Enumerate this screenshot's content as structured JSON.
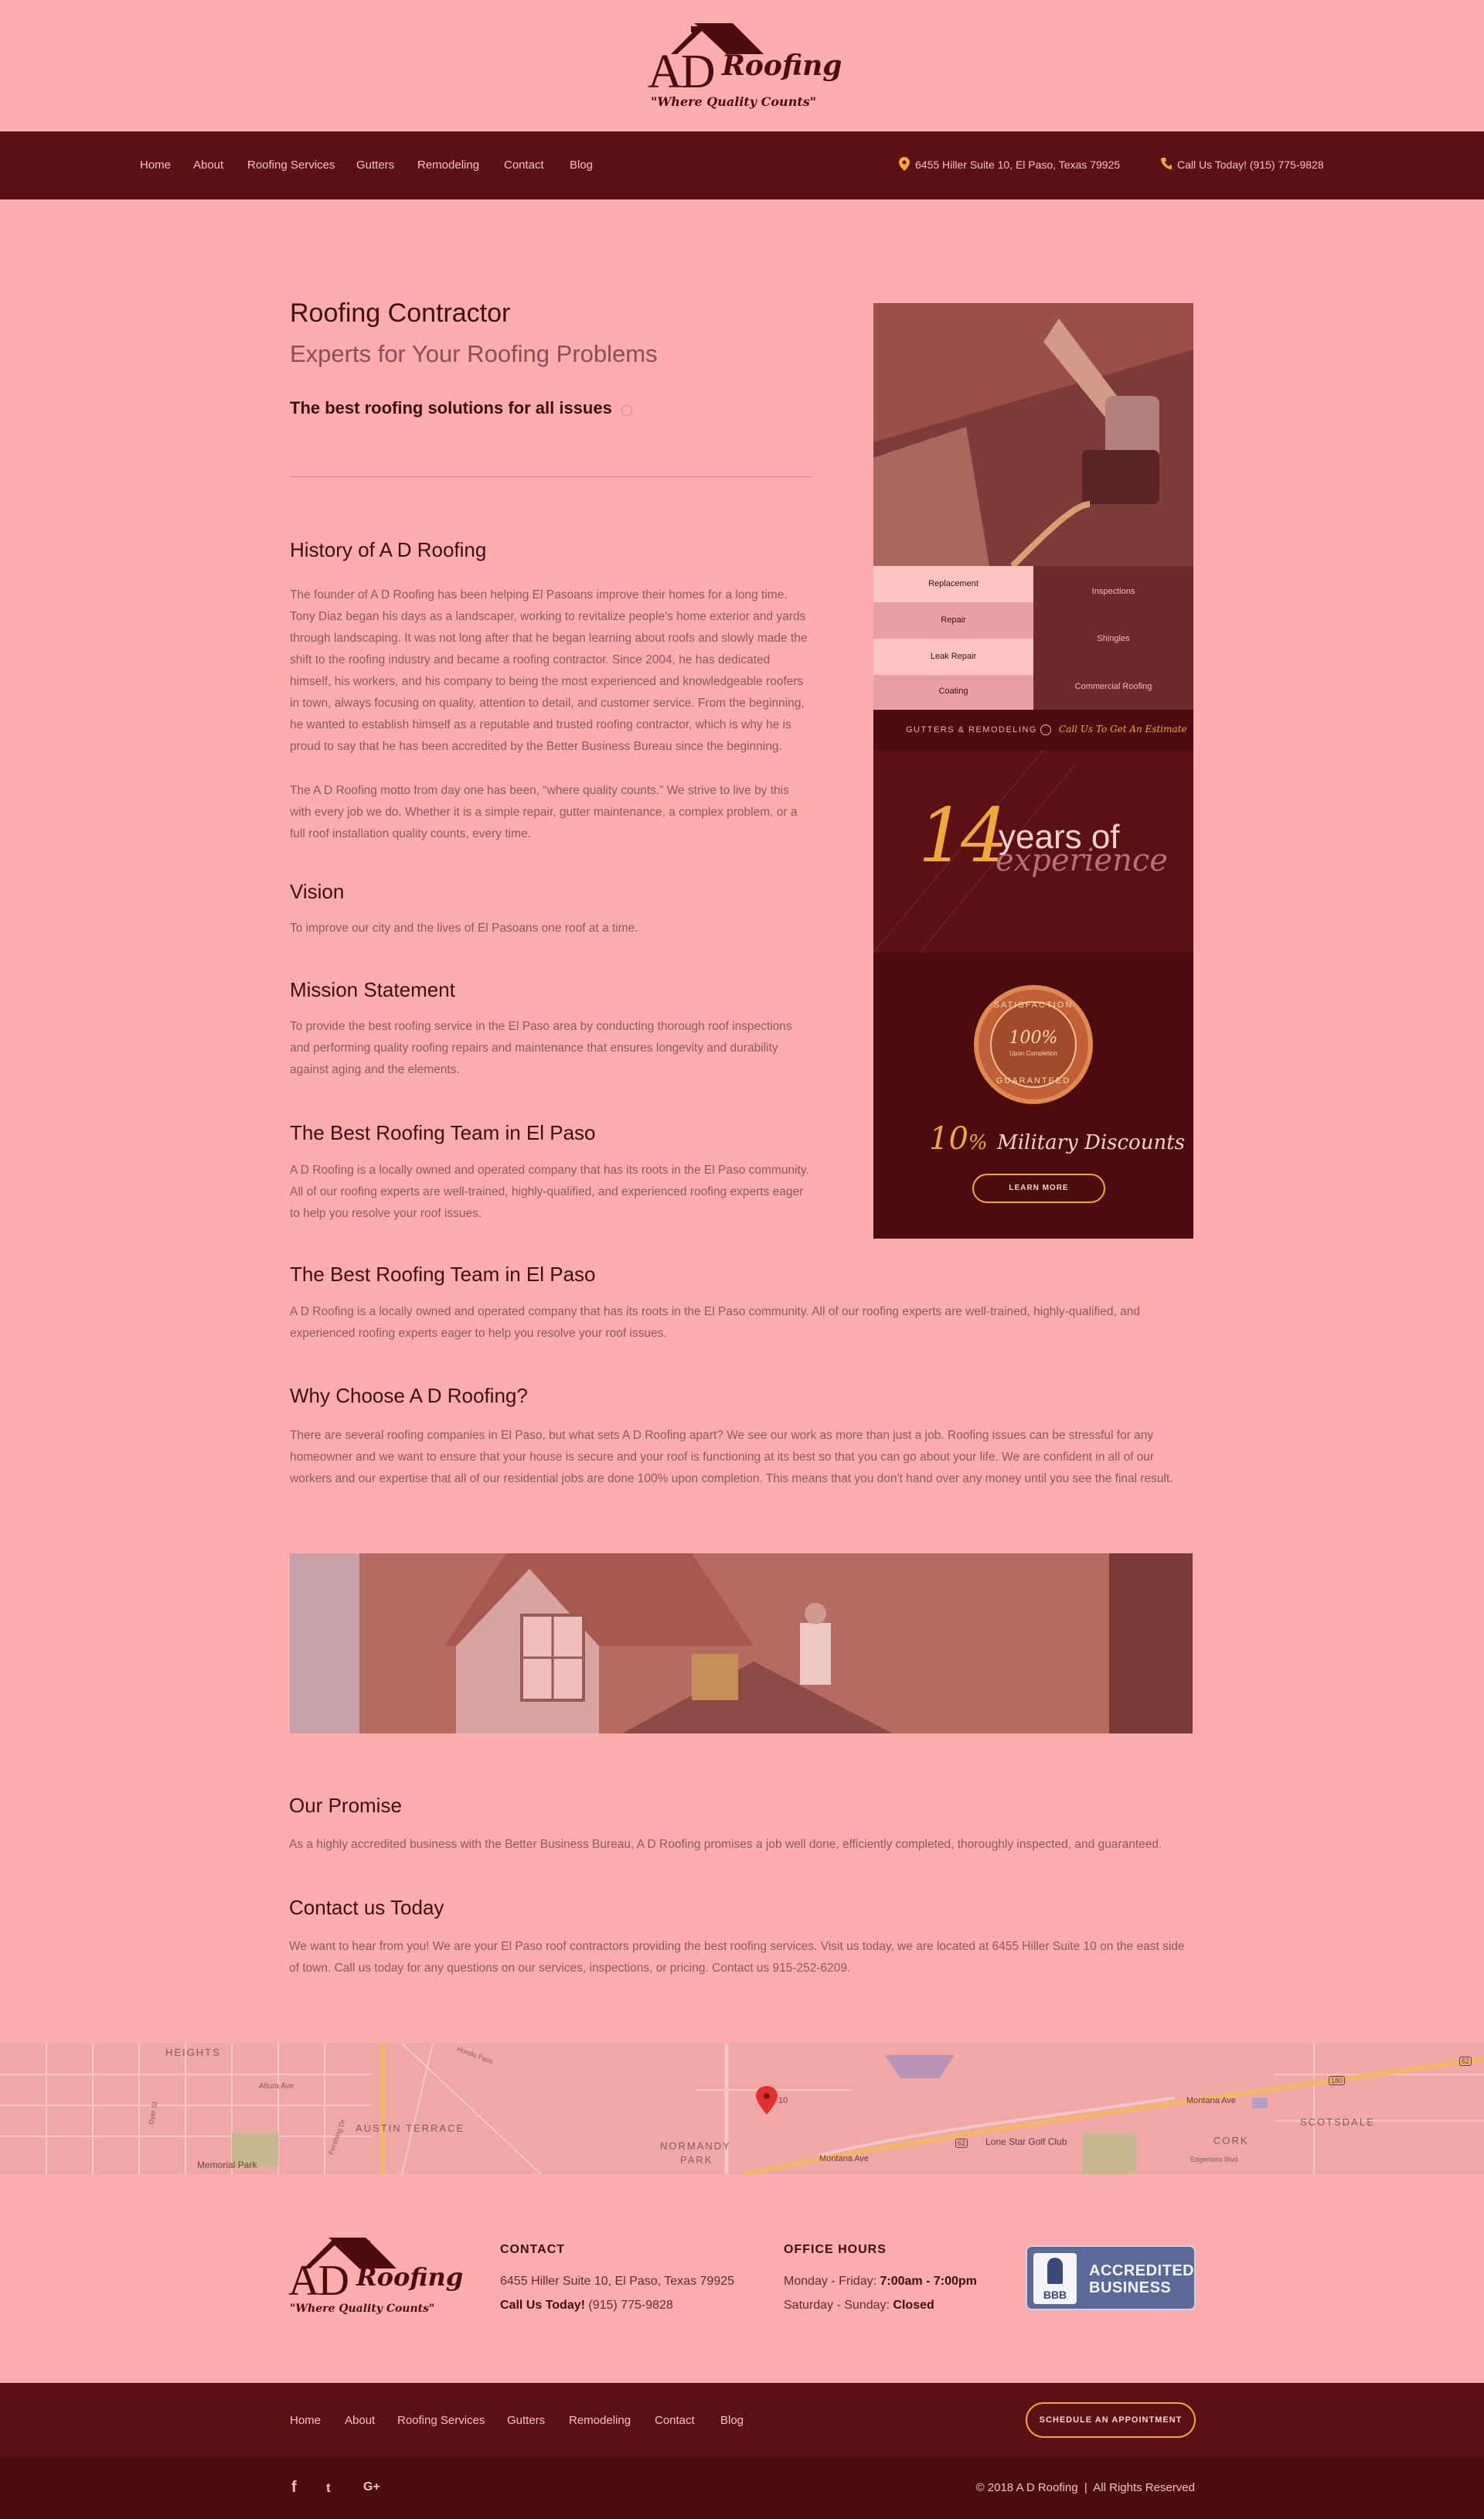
{
  "brand": {
    "name_big": "AD",
    "name_script": "Roofing",
    "tagline": "\"Where Quality Counts\""
  },
  "nav": {
    "items": [
      "Home",
      "About",
      "Roofing Services",
      "Gutters",
      "Remodeling",
      "Contact",
      "Blog"
    ],
    "address": "6455 Hiller Suite 10, El Paso, Texas 79925",
    "phone": "Call Us Today! (915) 775-9828"
  },
  "intro": {
    "title": "Roofing Contractor",
    "subtitle": "Experts for Your Roofing Problems",
    "tagline": "The best roofing solutions for all issues"
  },
  "sections": [
    {
      "heading": "History of A D Roofing",
      "paragraphs": [
        "The founder of A D Roofing has been helping El Pasoans improve their homes for a long time. Tony Diaz began his days as a landscaper, working to revitalize people's home exterior and yards through landscaping. It was not long after that he began learning about roofs and slowly made the shift to the roofing industry and became a roofing contractor. Since 2004, he has dedicated himself, his workers, and his company to being the most experienced and knowledgeable roofers in town, always focusing on quality, attention to detail, and customer service. From the beginning, he wanted to establish himself as a reputable and trusted roofing contractor, which is why he is proud to say that he has been accredited by the Better Business Bureau since the beginning.",
        "The A D Roofing motto from day one has been, “where quality counts.” We strive to live by this with every job we do. Whether it is a simple repair, gutter maintenance, a complex problem, or a full roof installation quality counts, every time."
      ]
    },
    {
      "heading": "Vision",
      "paragraphs": [
        "To improve our city and the lives of El Pasoans one roof at a time."
      ]
    },
    {
      "heading": "Mission Statement",
      "paragraphs": [
        "To provide the best roofing service in the El Paso area by conducting thorough roof inspections and performing quality roofing repairs and maintenance that ensures longevity and durability against aging and the elements."
      ]
    },
    {
      "heading": "The Best Roofing Team in El Paso",
      "paragraphs": [
        "A D Roofing is a locally owned and operated company that has its roots in the El Paso community. All of our roofing experts are well-trained, highly-qualified, and experienced roofing experts eager to help you resolve your roof issues."
      ]
    },
    {
      "heading": "The Best Roofing Team in El Paso",
      "paragraphs": [
        "A D Roofing is a locally owned and operated company that has its roots in the El Paso community. All of our roofing experts are well-trained, highly-qualified, and experienced roofing experts eager to help you resolve your roof issues."
      ]
    },
    {
      "heading": "Why Choose A D Roofing?",
      "paragraphs": [
        "There are several roofing companies in El Paso, but what sets A D Roofing apart? We see our work as more than just a job. Roofing issues can be stressful for any homeowner and we want to ensure that your house is secure and your roof is functioning at its best so that you can go about your life.  We are confident in all of our workers and our expertise that all of our residential jobs are done 100% upon completion. This means that you don't hand over any money until you see the final result."
      ]
    },
    {
      "heading": "Our Promise",
      "paragraphs": [
        "As a highly accredited business with the Better Business Bureau, A D Roofing promises a job well done, efficiently completed, thoroughly inspected, and guaranteed."
      ]
    },
    {
      "heading": "Contact us Today",
      "paragraphs": [
        "We want to hear from you! We are your El Paso roof contractors providing the best roofing services. Visit us today, we are located at 6455 Hiller Suite 10 on the east side of town. Call us today for any questions on our services, inspections, or pricing. Contact us 915-252-6209."
      ]
    }
  ],
  "sidebar": {
    "services_left": [
      "Replacement",
      "Repair",
      "Leak Repair",
      "Coating"
    ],
    "services_right": [
      "Inspections",
      "Shingles",
      "Commercial Roofing"
    ],
    "banner_left": "GUTTERS & REMODELING",
    "banner_right": "Call Us To Get An Estimate",
    "years_number": "14",
    "years_text": "years of",
    "years_script": "experience",
    "seal_top": "SATISFACTION",
    "seal_pct": "100%",
    "seal_mid": "Upon Completion",
    "seal_bottom": "GUARANTEED",
    "discount_pct": "10",
    "discount_sym": "%",
    "discount_text": "Military Discounts",
    "learn_more": "LEARN MORE"
  },
  "map": {
    "labels": [
      "HEIGHTS",
      "Altura Ave",
      "AUSTIN TERRACE",
      "Memorial Park",
      "NORMANDY",
      "PARK",
      "Montana Ave",
      "Lone Star Golf Club",
      "CORK",
      "SCOTSDALE",
      "Edgemere Blvd",
      "Montana Ave",
      "Pershing Dr",
      "Dyer St",
      "Hondo Pass",
      "10",
      "62",
      "180",
      "62"
    ]
  },
  "footer": {
    "contact_heading": "CONTACT",
    "contact_address": "6455 Hiller Suite 10, El Paso, Texas 79925",
    "contact_phone_label": "Call Us Today!",
    "contact_phone": "(915) 775-9828",
    "hours_heading": "OFFICE HOURS",
    "hours_weekday_label": "Monday - Friday:",
    "hours_weekday": "7:00am - 7:00pm",
    "hours_weekend_label": "Saturday -  Sunday:",
    "hours_weekend": "Closed",
    "bbb_small": "BBB",
    "bbb_line1": "ACCREDITED",
    "bbb_line2": "BUSINESS",
    "nav": [
      "Home",
      "About",
      "Roofing Services",
      "Gutters",
      "Remodeling",
      "Contact",
      "Blog"
    ],
    "cta": "SCHEDULE AN APPOINTMENT",
    "social": [
      "f",
      "t",
      "G+"
    ],
    "copyright": "© 2018 A D Roofing  |  All Rights Reserved"
  },
  "colors": {
    "bg": "#fdadab",
    "nav": "#5b1114",
    "accent": "#f0a83a",
    "dark": "#4a0c0e"
  }
}
